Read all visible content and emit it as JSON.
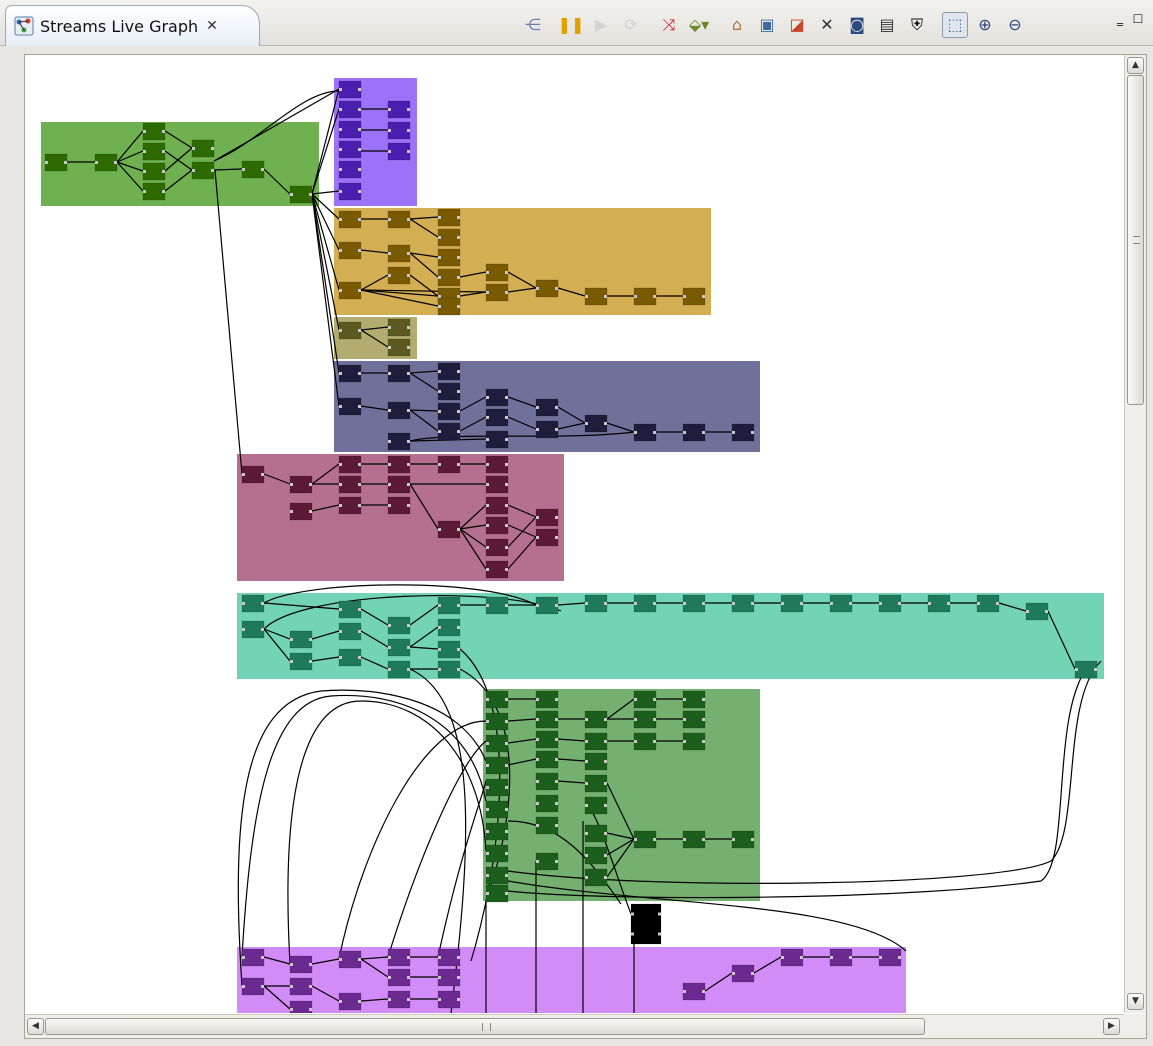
{
  "view": {
    "tab_title": "Streams Live Graph",
    "close_glyph": "✕"
  },
  "toolbar": [
    {
      "name": "layout-icon",
      "glyph": "⋲",
      "color": "#6a7fae"
    },
    {
      "name": "pause-icon",
      "glyph": "❚❚",
      "color": "#e0a000"
    },
    {
      "name": "resume-icon",
      "glyph": "▶",
      "color": "#b9b9b9",
      "dim": true
    },
    {
      "name": "refresh-icon",
      "glyph": "⟳",
      "color": "#b9b9b9",
      "dim": true
    },
    {
      "name": "highlight-icon",
      "glyph": "⤨",
      "color": "#cc2a2a"
    },
    {
      "name": "color-scheme-icon",
      "glyph": "⬙▾",
      "color": "#6c8a2c"
    },
    {
      "name": "home-icon",
      "glyph": "⌂",
      "color": "#b0783a"
    },
    {
      "name": "save-icon",
      "glyph": "▣",
      "color": "#3c6aa0"
    },
    {
      "name": "export-icon",
      "glyph": "◪",
      "color": "#c8442a"
    },
    {
      "name": "fit-to-window-icon",
      "glyph": "✕",
      "color": "#333333"
    },
    {
      "name": "snapshot-icon",
      "glyph": "◙",
      "color": "#2a4a80"
    },
    {
      "name": "properties-icon",
      "glyph": "▤",
      "color": "#333333"
    },
    {
      "name": "find-icon",
      "glyph": "⛨",
      "color": "#111111"
    },
    {
      "name": "select-mode-icon",
      "glyph": "⬚",
      "color": "#4a6a9a",
      "pressed": true
    },
    {
      "name": "zoom-in-icon",
      "glyph": "⊕",
      "color": "#2a4a80"
    },
    {
      "name": "zoom-out-icon",
      "glyph": "⊖",
      "color": "#2a4a80"
    }
  ],
  "window_controls": {
    "minimize": "‗",
    "maximize": "☐"
  },
  "scrollbars": {
    "up": "▲",
    "down": "▼",
    "left": "◀",
    "right": "▶",
    "vertical_thumb_glyph": "≡",
    "horizontal_thumb_glyph": "III"
  },
  "graph": {
    "background": "#ffffff",
    "operator_colors": [
      "#2d6b00",
      "#4a1fb0",
      "#7a5a00",
      "#5a5a20",
      "#1e1e3c",
      "#5c1a36",
      "#1e7a5a",
      "#1c5e1c",
      "#6a2a90",
      "#000000"
    ],
    "job_region_colors": [
      "#6fb050",
      "#9b72f8",
      "#d4ae52",
      "#b2ac70",
      "#70709a",
      "#b4708e",
      "#72d4b4",
      "#74b070",
      "#d28cf8"
    ],
    "link_color": "#000000",
    "port_color": "#c8c8c8"
  }
}
